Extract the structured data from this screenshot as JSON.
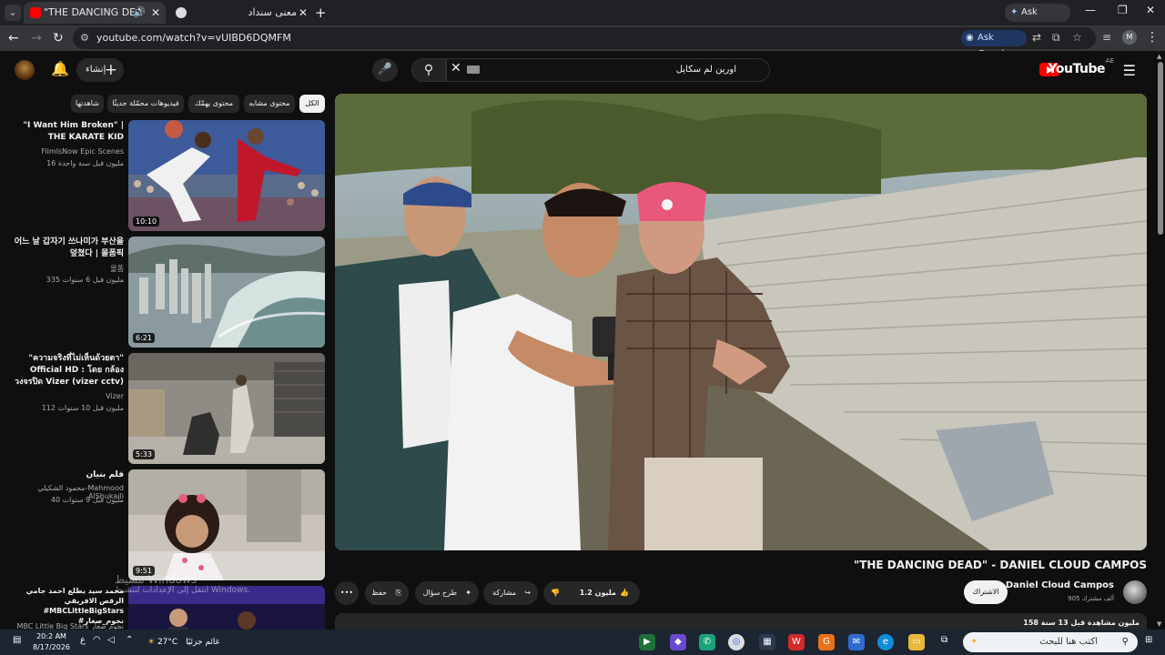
{
  "browser": {
    "tabs": [
      {
        "title": "\"THE DANCING DEAD\" - DA",
        "active": true
      },
      {
        "title": "معنى سنداد",
        "active": false
      }
    ],
    "ask_gemini": "Ask Gemini",
    "url": "youtube.com/watch?v=vUIBD6DQMFM",
    "ask_google": "Ask Google",
    "profile_initial": "M"
  },
  "youtube": {
    "logo": "YouTube",
    "region": "AE",
    "search_query": "اورين لم سكايل",
    "create_label": "إنشاء",
    "chips": [
      {
        "label": "الكل",
        "selected": true
      },
      {
        "label": "محتوى مشابه",
        "selected": false
      },
      {
        "label": "محتوى يهمّك",
        "selected": false
      },
      {
        "label": "فيديوهات محمّلة حديثًا",
        "selected": false
      },
      {
        "label": "شاهدتها",
        "selected": false
      }
    ],
    "related": [
      {
        "title": "\"I Want Him Broken\" | THE KARATE KID",
        "channel": "FilmIsNow Epic Scenes",
        "meta": "16 مليون  قبل سنة واحدة",
        "duration": "10:10"
      },
      {
        "title": "어느 날 갑자기 쓰나미가 부산을 덮쳤다 | 몰폼픽",
        "channel": "몰폼",
        "meta": "335 مليون  قبل 6 سنوات",
        "duration": "6:21"
      },
      {
        "title": "\"ความจริงที่ไม่เห็นด้วยตา\" Official HD : โดย กล้องวงจรปิด Vizer (vizer cctv)",
        "channel": "Vizer",
        "meta": "112 مليون  قبل 10 سنوات",
        "duration": "5:33"
      },
      {
        "title": "فلم بنيان",
        "channel": "محمود الشكيلي-Mahmood AlShukaili",
        "meta": "40 مليون  قبل 9 سنوات",
        "duration": "9:51"
      },
      {
        "title": "محمد سيد يطلع احمد جامي الرقص الافريقي #MBCLittleBigStars #نجوم_صغار",
        "channel": "MBC Little Big Stars نجوم صغار",
        "meta": "",
        "duration": ""
      }
    ],
    "video": {
      "title": "\"THE DANCING DEAD\" - DANIEL CLOUD CAMPOS",
      "channel": "Daniel Cloud Campos",
      "subscribers": "905 ألف مشترك",
      "subscribe_label": "الاشتراك",
      "likes": "1.2 مليون",
      "share": "مشاركة",
      "ask": "طرح سؤال",
      "save": "حفظ",
      "stats": "158 مليون مشاهدة  قبل 13 سنة"
    },
    "overlay": {
      "activate_title": "تنشيط Windows",
      "activate_sub": "انتقل إلى الإعدادات لتنشيط Windows."
    }
  },
  "taskbar": {
    "search_placeholder": "اكتب هنا للبحث",
    "weather_temp": "27°C",
    "weather_text": "غائم جزئيًا",
    "time": "20:2 AM",
    "date": "8/17/2026",
    "lang": "ع"
  },
  "colors": {
    "background": "#0f0f0f",
    "accent": "#ff0000"
  }
}
